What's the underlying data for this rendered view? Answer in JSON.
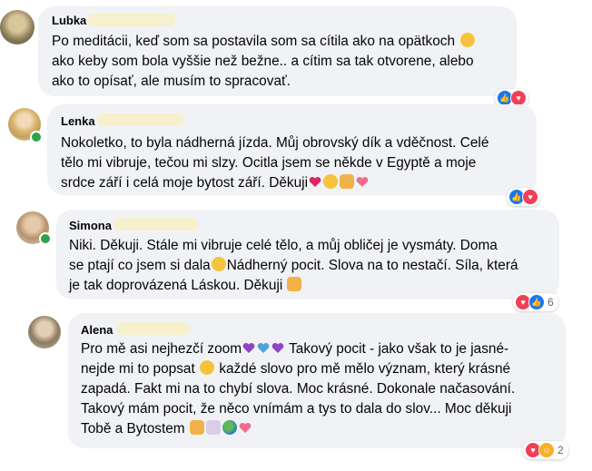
{
  "comments": [
    {
      "author": "Lubka",
      "lines": [
        "Po meditácii, keď som sa postavila som sa cítila ako na opätkoch",
        "ako keby som bola vyššie než bežne.. a cítim sa tak otvorene, alebo",
        "ako to opísať, ale musím to spracovať."
      ]
    },
    {
      "author": "Lenka",
      "lines": [
        "Nokoletko, to byla nádherná jízda. Můj obrovský dík a vděčnost. Celé",
        "tělo mi vibruje, tečou mi slzy. Ocitla jsem se někde v Egyptě a moje",
        "srdce září i celá moje bytost září. Děkuji"
      ]
    },
    {
      "author": "Simona",
      "lines": [
        "Niki. Děkuji. Stále mi vibruje celé tělo, a můj obličej je vysmáty. Doma",
        "se ptají co jsem si dala",
        "Nádherný pocit. Slova na to nestačí. Síla, která",
        "je tak doprovázená Láskou. Děkuji"
      ],
      "reaction_count": "6"
    },
    {
      "author": "Alena",
      "lines": [
        "Pro mě asi nejhezčí zoom",
        "Takový pocit - jako však to je jasné-",
        "nejde mi to popsat",
        "každé slovo pro mě mělo význam, který krásné",
        "zapadá. Fakt mi na to chybí slova. Moc krásné. Dokonale načasování.",
        "Takový mám pocit, že něco vnímám a tys to dala do slov... Moc děkuji",
        "Tobě a Bytostem"
      ],
      "reaction_count": "2"
    }
  ],
  "colors": {
    "bubble": "#f0f2f5",
    "online": "#31a24c",
    "like": "#1877f2",
    "love": "#f33e58",
    "care": "#f7b125"
  }
}
